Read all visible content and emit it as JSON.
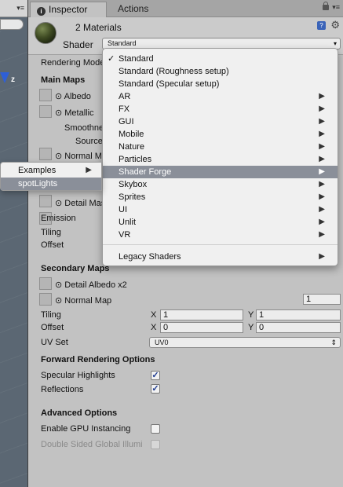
{
  "scene": {
    "axis_label": "z",
    "menu_glyph": "▾≡"
  },
  "tabs": [
    {
      "label": "Inspector",
      "icon": "info-icon"
    },
    {
      "label": "Actions"
    }
  ],
  "tabbar": {
    "menu_glyph": "▾≡"
  },
  "header": {
    "title": "2 Materials",
    "shader_label": "Shader",
    "shader_value": "Standard",
    "dropdown_arrow": "▾",
    "help_glyph": "?",
    "gear_glyph": "⚙"
  },
  "properties": {
    "rendering_mode": "Rendering Mode",
    "main_maps": "Main Maps",
    "albedo": "⊙ Albedo",
    "metallic": "⊙ Metallic",
    "smoothness": "Smoothness",
    "source": "Source",
    "normal_map_main": "⊙ Normal Map",
    "detail_mask": "⊙ Detail Mask",
    "emission": "Emission",
    "tiling": "Tiling",
    "offset": "Offset",
    "secondary_maps": "Secondary Maps",
    "detail_albedo": "⊙ Detail Albedo x2",
    "normal_map_secondary": "⊙ Normal Map",
    "normal_map_value": "1",
    "tiling2": "Tiling",
    "offset2": "Offset",
    "x_label": "X",
    "y_label": "Y",
    "tiling_x": "1",
    "tiling_y": "1",
    "offset_x": "0",
    "offset_y": "0",
    "uv_set": "UV Set",
    "uv_value": "UV0",
    "uv_arrow": "⇕",
    "forward_rendering": "Forward Rendering Options",
    "specular_highlights": "Specular Highlights",
    "reflections": "Reflections",
    "check_glyph": "✓",
    "advanced_options": "Advanced Options",
    "gpu_instancing": "Enable GPU Instancing",
    "double_sided": "Double Sided Global Illumi"
  },
  "shader_menu": {
    "checked_glyph": "✓",
    "submenu_glyph": "▶",
    "items": [
      {
        "label": "Standard",
        "checked": true
      },
      {
        "label": "Standard (Roughness setup)"
      },
      {
        "label": "Standard (Specular setup)"
      },
      {
        "label": "AR",
        "submenu": true
      },
      {
        "label": "FX",
        "submenu": true
      },
      {
        "label": "GUI",
        "submenu": true
      },
      {
        "label": "Mobile",
        "submenu": true
      },
      {
        "label": "Nature",
        "submenu": true
      },
      {
        "label": "Particles",
        "submenu": true
      },
      {
        "label": "Shader Forge",
        "submenu": true,
        "highlighted": true
      },
      {
        "label": "Skybox",
        "submenu": true
      },
      {
        "label": "Sprites",
        "submenu": true
      },
      {
        "label": "UI",
        "submenu": true
      },
      {
        "label": "Unlit",
        "submenu": true
      },
      {
        "label": "VR",
        "submenu": true
      },
      {
        "label": "Legacy Shaders",
        "submenu": true
      }
    ]
  },
  "sub_menu": {
    "items": [
      {
        "label": "Examples",
        "submenu": true
      },
      {
        "label": "spotLights",
        "highlighted": true
      }
    ]
  },
  "colors": {
    "highlight": "#8a8f99",
    "panel": "#c2c2c2",
    "menu": "#f0f0f0"
  }
}
